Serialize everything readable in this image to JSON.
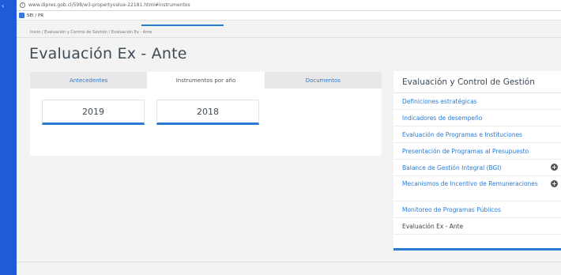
{
  "browser": {
    "url": "www.dipres.gob.cl/598/w3-propertyvalue-22181.html#instrumentos",
    "bookmark": "SEI / PR"
  },
  "breadcrumb": "Inicio / Evaluación y Control de Gestión / Evaluación Ex - Ante",
  "page": {
    "title": "Evaluación Ex - Ante"
  },
  "tabs": [
    {
      "label": "Antecedentes"
    },
    {
      "label": "Instrumentos por año"
    },
    {
      "label": "Documentos"
    }
  ],
  "years": [
    "2019",
    "2018"
  ],
  "sidebar": {
    "title": "Evaluación y Control de Gestión",
    "items": [
      {
        "label": "Definiciones estratégicas"
      },
      {
        "label": "Indicadores de desempeño"
      },
      {
        "label": "Evaluación de Programas e Instituciones"
      },
      {
        "label": "Presentación de Programas al Presupuesto"
      },
      {
        "label": "Balance de Gestión Integral (BGI)"
      },
      {
        "label": "Mecanismos de Incentivo de Remuneraciones"
      },
      {
        "label": "Monitoreo de Programas Públicos"
      },
      {
        "label": "Evaluación Ex - Ante"
      }
    ]
  }
}
